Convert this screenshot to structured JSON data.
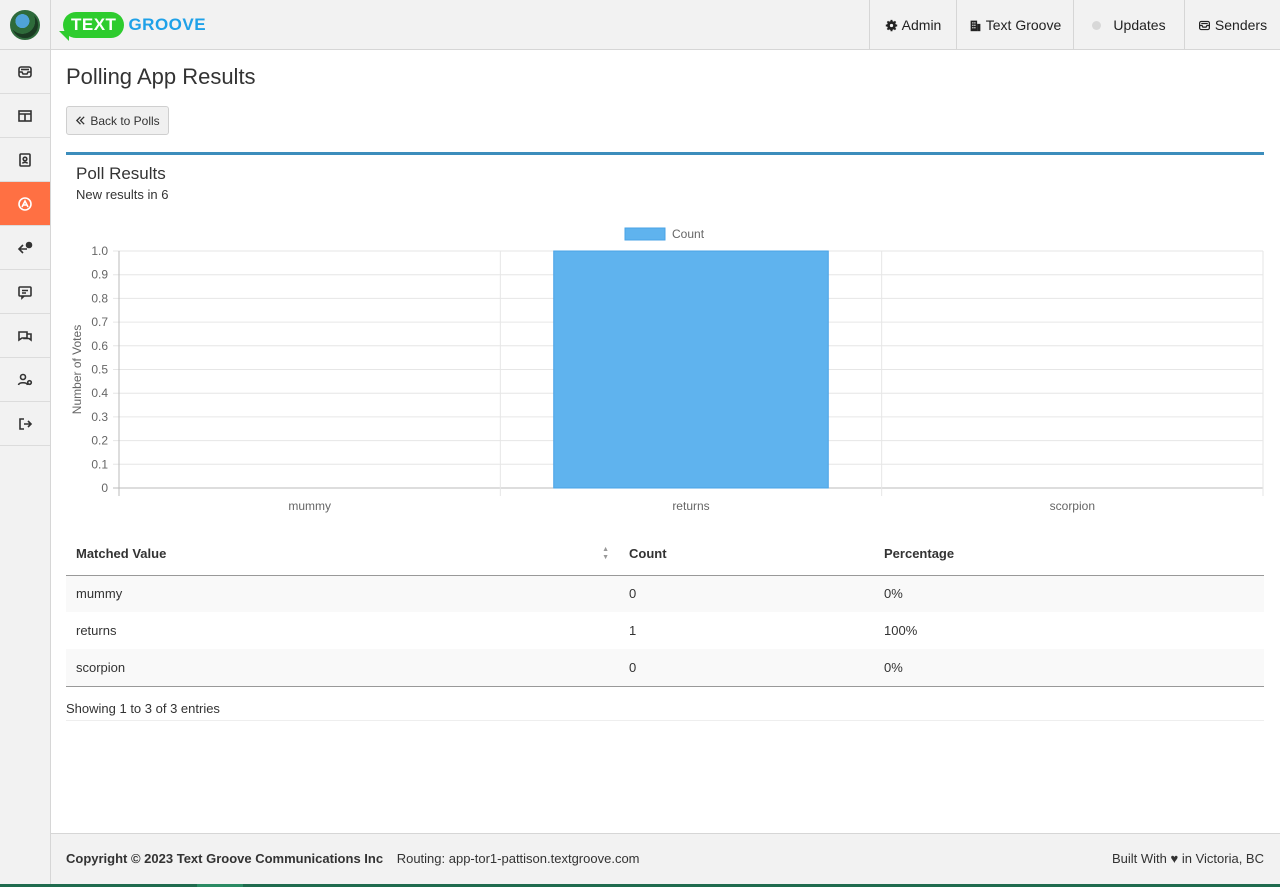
{
  "brand": {
    "word1": "TEXT",
    "word2": "GROOVE"
  },
  "topnav": [
    {
      "label": "Admin",
      "icon": "gear-icon"
    },
    {
      "label": "Text Groove",
      "icon": "building-icon"
    },
    {
      "label": "Updates",
      "icon": "status-dot-icon"
    },
    {
      "label": "Senders",
      "icon": "inbox-icon"
    }
  ],
  "sidebar": {
    "items": [
      {
        "name": "inbox",
        "icon": "inbox-icon"
      },
      {
        "name": "layout",
        "icon": "columns-icon"
      },
      {
        "name": "contacts",
        "icon": "contact-book-icon"
      },
      {
        "name": "apps",
        "icon": "apps-icon",
        "active": true
      },
      {
        "name": "reply",
        "icon": "reply-icon"
      },
      {
        "name": "messages",
        "icon": "message-icon"
      },
      {
        "name": "chats",
        "icon": "chat-bubbles-icon"
      },
      {
        "name": "user-settings",
        "icon": "user-gear-icon"
      },
      {
        "name": "logout",
        "icon": "logout-icon"
      }
    ],
    "active_color": "#ff7043"
  },
  "page": {
    "title": "Polling App Results",
    "back_label": "Back to Polls"
  },
  "panel": {
    "title": "Poll Results",
    "subtitle": "New results in 6"
  },
  "chart_data": {
    "type": "bar",
    "categories": [
      "mummy",
      "returns",
      "scorpion"
    ],
    "series": [
      {
        "name": "Count",
        "values": [
          0,
          1,
          0
        ],
        "color": "#5fb3ee"
      }
    ],
    "ylabel": "Number of Votes",
    "xlabel": "",
    "ylim": [
      0,
      1.0
    ],
    "yticks": [
      "1.0",
      "0.9",
      "0.8",
      "0.7",
      "0.6",
      "0.5",
      "0.4",
      "0.3",
      "0.2",
      "0.1",
      "0"
    ],
    "grid": true,
    "legend": "top"
  },
  "table": {
    "columns": [
      "Matched Value",
      "Count",
      "Percentage"
    ],
    "rows": [
      [
        "mummy",
        "0",
        "0%"
      ],
      [
        "returns",
        "1",
        "100%"
      ],
      [
        "scorpion",
        "0",
        "0%"
      ]
    ],
    "info": "Showing 1 to 3 of 3 entries"
  },
  "footer": {
    "copyright": "Copyright © 2023 Text Groove Communications Inc",
    "routing": "Routing: app-tor1-pattison.textgroove.com",
    "built_prefix": "Built With",
    "built_suffix": "in Victoria, BC"
  },
  "colors": {
    "accent": "#3c8dbc",
    "brand_green": "#2ecc2e",
    "brand_blue": "#1fa1e8"
  }
}
